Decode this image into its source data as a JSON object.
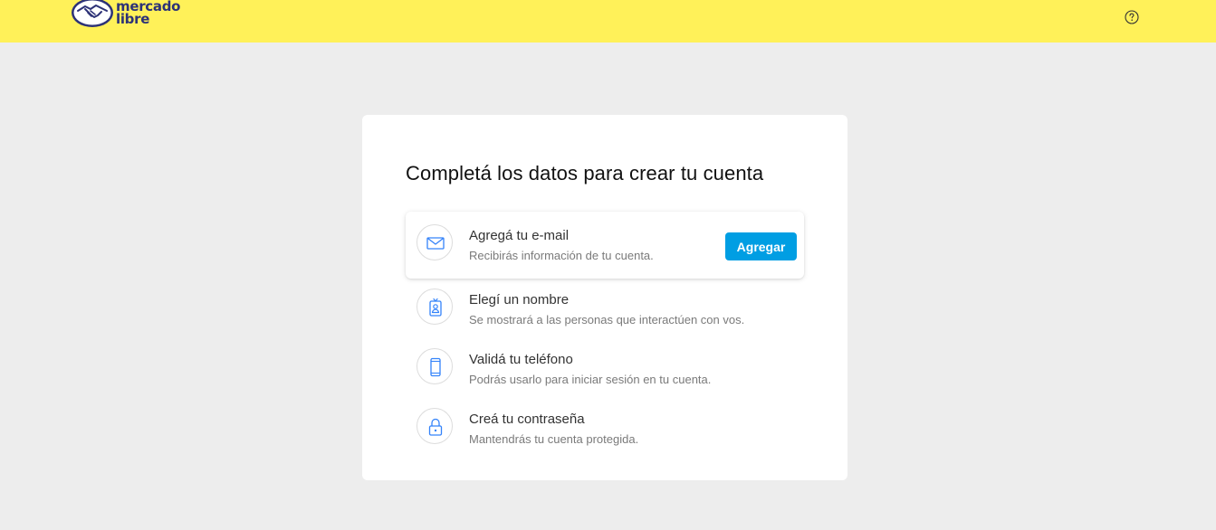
{
  "header": {
    "logo_line1": "mercado",
    "logo_line2": "libre",
    "help_icon": "question-circle-icon"
  },
  "card": {
    "title": "Completá los datos para crear tu cuenta",
    "steps": [
      {
        "title": "Agregá tu e-mail",
        "description": "Recibirás información de tu cuenta.",
        "icon": "envelope-icon",
        "button_label": "Agregar"
      },
      {
        "title": "Elegí un nombre",
        "description": "Se mostrará a las personas que interactúen con vos.",
        "icon": "id-badge-icon"
      },
      {
        "title": "Validá tu teléfono",
        "description": "Podrás usarlo para iniciar sesión en tu cuenta.",
        "icon": "phone-icon"
      },
      {
        "title": "Creá tu contraseña",
        "description": "Mantendrás tu cuenta protegida.",
        "icon": "lock-icon"
      }
    ]
  },
  "colors": {
    "header_bg": "#fff159",
    "page_bg": "#ededed",
    "accent": "#009ee3",
    "icon_blue": "#3483fa",
    "logo_navy": "#2d3277"
  }
}
